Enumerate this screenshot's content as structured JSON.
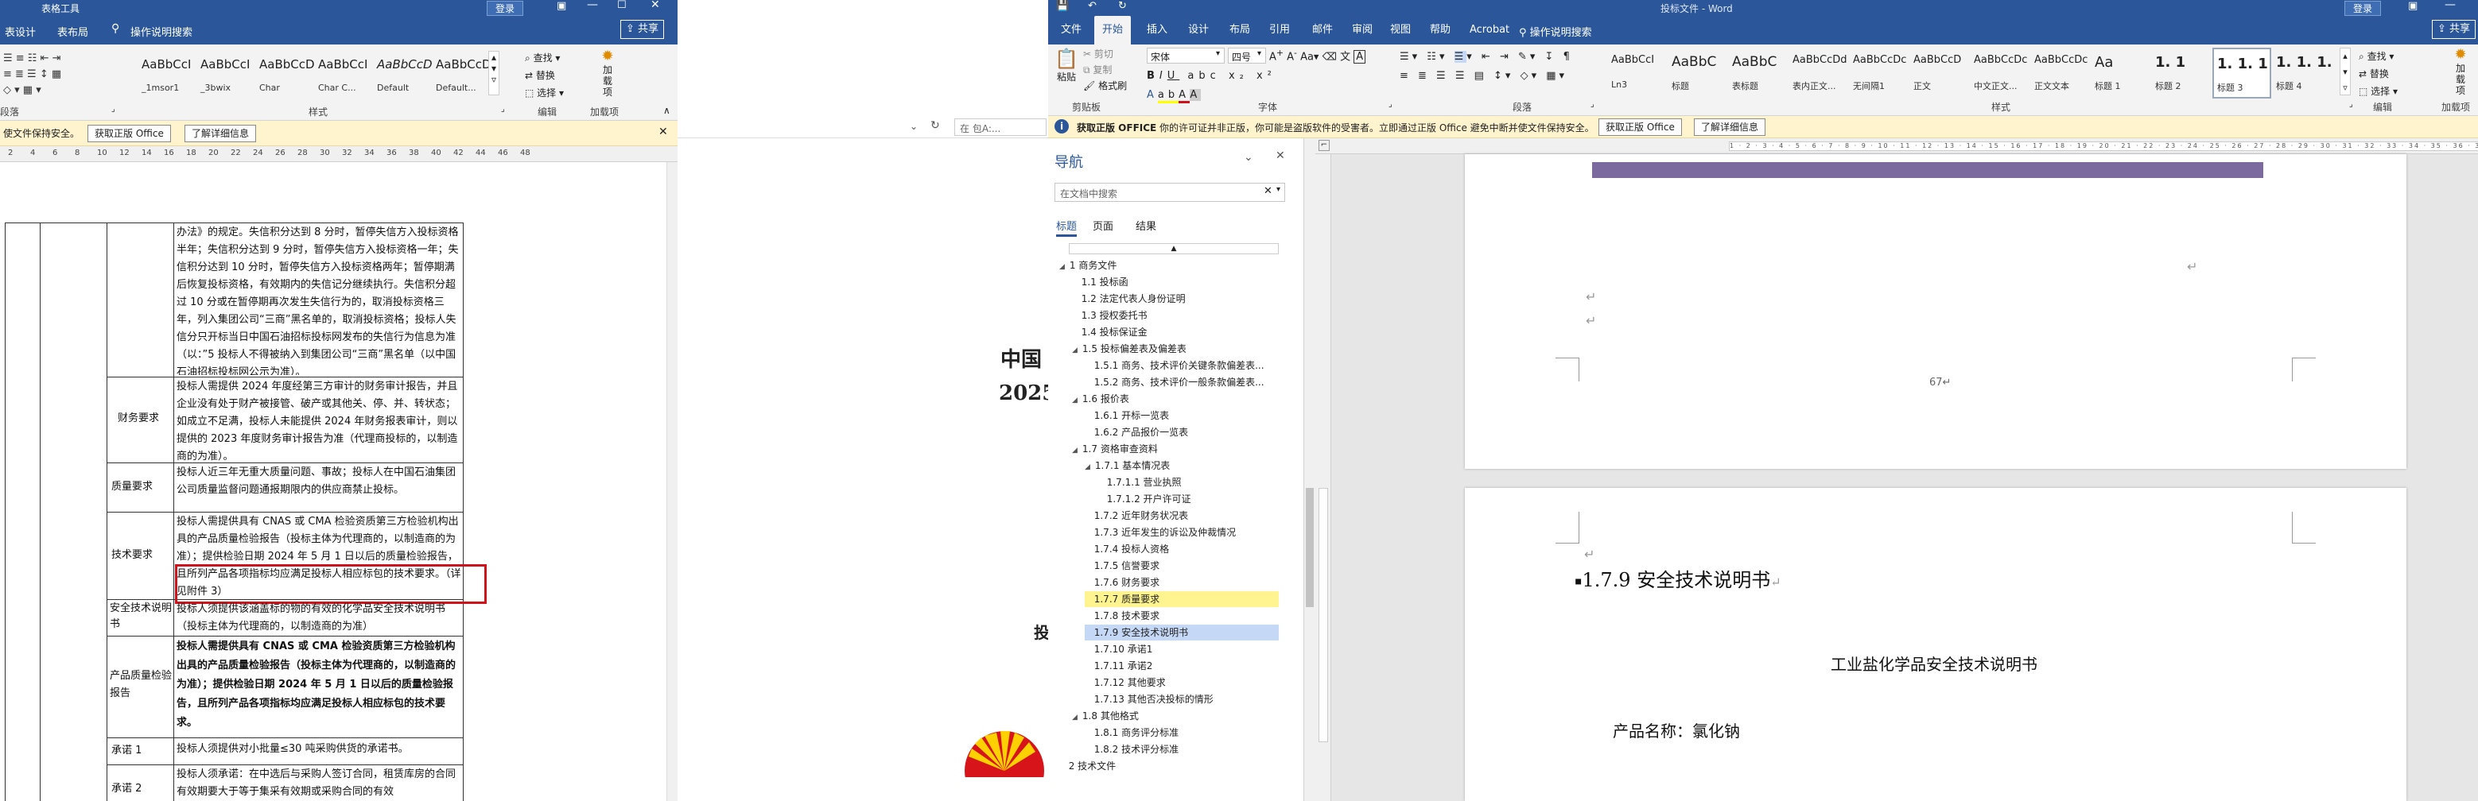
{
  "left_window": {
    "context_tab": "表格工具",
    "login": "登录",
    "tabs": [
      "表设计",
      "表布局"
    ],
    "search": "操作说明搜索",
    "share": "共享",
    "styles": [
      {
        "preview": "AaBbCcI",
        "name": "_1msor1"
      },
      {
        "preview": "AaBbCcI",
        "name": "_3bwix"
      },
      {
        "preview": "AaBbCcD",
        "name": "Char"
      },
      {
        "preview": "AaBbCcI",
        "name": "Char C..."
      },
      {
        "preview": "AaBbCcD",
        "name": "Default"
      },
      {
        "preview": "AaBbCcDc",
        "name": "Default..."
      }
    ],
    "find": "查找",
    "replace": "替换",
    "select": "选择",
    "group_labels": {
      "paragraph": "段落",
      "styles": "样式",
      "editing": "编辑",
      "addins": "加载项"
    },
    "addin": "加\n载\n项",
    "message": "使文件保持安全。",
    "btn_get_office": "获取正版 Office",
    "btn_learn_more": "了解详细信息",
    "ruler_numbers": [
      "2",
      "4",
      "6",
      "8",
      "10",
      "12",
      "14",
      "16",
      "18",
      "20",
      "22",
      "24",
      "26",
      "28",
      "30",
      "32",
      "34",
      "36",
      "38",
      "40",
      "42",
      "44",
      "46",
      "48"
    ],
    "table_rows": [
      {
        "label": "",
        "text": "办法》的规定。失信积分达到 8 分时，暂停失信方入投标资格半年；失信积分达到 9 分时，暂停失信方入投标资格一年；失信积分达到 10 分时，暂停失信方入投标资格两年；暂停期满后恢复投标资格，有效期内的失信记分继续执行。失信积分超过 10 分或在暂停期再次发生失信行为的，取消投标资格三年，列入集团公司“三商”黑名单的，取消投标资格；投标人失信分只开标当日中国石油招标投标网发布的失信行为信息为准（以：”5 投标人不得被纳入到集团公司“三商”黑名单（以中国石油招标投标网公示为准）。"
      },
      {
        "label": "财务要求",
        "text": "投标人需提供 2024 年度经第三方审计的财务审计报告，并且企业没有处于财产被接管、破产或其他关、停、并、转状态；如成立不足满，投标人未能提供 2024 年财务报表审计，则以提供的 2023 年度财务审计报告为准（代理商投标的，以制造商的为准）。"
      },
      {
        "label": "质量要求",
        "text": "投标人近三年无重大质量问题、事故；投标人在中国石油集团公司质量监督问题通报期限内的供应商禁止投标。"
      },
      {
        "label": "技术要求",
        "text": "投标人需提供具有 CNAS 或 CMA 检验资质第三方检验机构出具的产品质量检验报告（投标主体为代理商的，以制造商的为准）；提供检验日期 2024 年 5 月 1 日以后的质量检验报告，且所列产品各项指标均应满足投标人相应标包的技术要求。（详见附件 3）"
      },
      {
        "label": "安全技术说明书",
        "text": "投标人须提供该涵盖标的物的有效的化学品安全技术说明书（投标主体为代理商的，以制造商的为准）"
      },
      {
        "label": "产品质量检验报告",
        "text": "投标人需提供具有 CNAS 或 CMA 检验资质第三方检验机构出具的产品质量检验报告（投标主体为代理商的，以制造商的为准）；提供检验日期 2024 年 5 月 1 日以后的质量检验报告，且所列产品各项指标均应满足投标人相应标包的技术要求。"
      },
      {
        "label": "承诺 1",
        "text": "投标人须提供对小批量≤30 吨采购供货的承诺书。"
      },
      {
        "label": "承诺 2",
        "text": "投标人须承诺：在中选后与采购人签订合同，租赁库房的合同有效期要大于等于集采有效期或采购合同的有效"
      }
    ]
  },
  "middle_window": {
    "search_placeholder": "在 包A:...",
    "title_part1": "中国",
    "title_part2": "2025",
    "fragment": "投"
  },
  "right_window": {
    "title": "投标文件 - Word",
    "login": "登录",
    "tabs": [
      "文件",
      "开始",
      "插入",
      "设计",
      "布局",
      "引用",
      "邮件",
      "审阅",
      "视图",
      "帮助",
      "Acrobat"
    ],
    "active_tab": "开始",
    "search": "操作说明搜索",
    "share": "共享",
    "clipboard": {
      "cut": "剪切",
      "copy": "复制",
      "paste": "粘贴",
      "painter": "格式刷",
      "label": "剪贴板"
    },
    "font": {
      "name": "宋体",
      "size": "四号",
      "label": "字体"
    },
    "paragraph_label": "段落",
    "styles_label": "样式",
    "editing_label": "编辑",
    "addins_label": "加载项",
    "styles": [
      {
        "preview": "AaBbCcI",
        "name": "Ln3"
      },
      {
        "preview": "AaBbC",
        "name": "标题"
      },
      {
        "preview": "AaBbC",
        "name": "表标题"
      },
      {
        "preview": "AaBbCcDd",
        "name": "表内正文..."
      },
      {
        "preview": "AaBbCcDc",
        "name": "无间隔1"
      },
      {
        "preview": "AaBbCcD",
        "name": "正文"
      },
      {
        "preview": "AaBbCcDc",
        "name": "中文正文..."
      },
      {
        "preview": "AaBbCcDc",
        "name": "正文文本"
      },
      {
        "preview": "Aa",
        "name": "标题 1"
      },
      {
        "preview": "1. 1",
        "name": "标题 2"
      },
      {
        "preview": "1. 1. 1",
        "name": "标题 3"
      },
      {
        "preview": "1. 1. 1.",
        "name": "标题 4"
      }
    ],
    "find": "查找",
    "replace": "替换",
    "select": "选择",
    "addin": "加\n载\n项",
    "message_strong": "获取正版 OFFICE",
    "message": "你的许可证并非正版，你可能是盗版软件的受害者。立即通过正版 Office 避免中断并使文件保持安全。",
    "btn_get_office": "获取正版 Office",
    "btn_learn_more": "了解详细信息",
    "nav": {
      "title": "导航",
      "search_placeholder": "在文档中搜索",
      "tabs": [
        "标题",
        "页面",
        "结果"
      ],
      "items": [
        {
          "text": "1 商务文件",
          "level": 0,
          "state": ""
        },
        {
          "text": "1.1 投标函",
          "level": 1,
          "state": ""
        },
        {
          "text": "1.2 法定代表人身份证明",
          "level": 1,
          "state": ""
        },
        {
          "text": "1.3 授权委托书",
          "level": 1,
          "state": ""
        },
        {
          "text": "1.4 投标保证金",
          "level": 1,
          "state": ""
        },
        {
          "text": "1.5 投标偏差表及偏差表",
          "level": 1,
          "state": ""
        },
        {
          "text": "1.5.1 商务、技术评价关键条款偏差表...",
          "level": 2,
          "state": ""
        },
        {
          "text": "1.5.2 商务、技术评价一般条款偏差表...",
          "level": 2,
          "state": ""
        },
        {
          "text": "1.6 报价表",
          "level": 1,
          "state": ""
        },
        {
          "text": "1.6.1 开标一览表",
          "level": 2,
          "state": ""
        },
        {
          "text": "1.6.2 产品报价一览表",
          "level": 2,
          "state": ""
        },
        {
          "text": "1.7 资格审查资料",
          "level": 1,
          "state": ""
        },
        {
          "text": "1.7.1 基本情况表",
          "level": 2,
          "state": ""
        },
        {
          "text": "1.7.1.1 营业执照",
          "level": 3,
          "state": ""
        },
        {
          "text": "1.7.1.2 开户许可证",
          "level": 3,
          "state": ""
        },
        {
          "text": "1.7.2 近年财务状况表",
          "level": 2,
          "state": ""
        },
        {
          "text": "1.7.3 近年发生的诉讼及仲裁情况",
          "level": 2,
          "state": ""
        },
        {
          "text": "1.7.4 投标人资格",
          "level": 2,
          "state": ""
        },
        {
          "text": "1.7.5 信誉要求",
          "level": 2,
          "state": ""
        },
        {
          "text": "1.7.6 财务要求",
          "level": 2,
          "state": ""
        },
        {
          "text": "1.7.7 质量要求",
          "level": 2,
          "state": "hl"
        },
        {
          "text": "1.7.8 技术要求",
          "level": 2,
          "state": ""
        },
        {
          "text": "1.7.9 安全技术说明书",
          "level": 2,
          "state": "sel"
        },
        {
          "text": "1.7.10 承诺1",
          "level": 2,
          "state": ""
        },
        {
          "text": "1.7.11 承诺2",
          "level": 2,
          "state": ""
        },
        {
          "text": "1.7.12 其他要求",
          "level": 2,
          "state": ""
        },
        {
          "text": "1.7.13 其他否决投标的情形",
          "level": 2,
          "state": ""
        },
        {
          "text": "1.8 其他格式",
          "level": 1,
          "state": ""
        },
        {
          "text": "1.8.1 商务评分标准",
          "level": 2,
          "state": ""
        },
        {
          "text": "1.8.2 技术评分标准",
          "level": 2,
          "state": ""
        },
        {
          "text": "2 技术文件",
          "level": 0,
          "state": ""
        }
      ]
    },
    "page1_number": "67",
    "heading": "1.7.9  安全技术说明书",
    "doc_title": "工业盐化学品安全技术说明书",
    "product_line": "产品名称：氯化钠"
  },
  "colors": {
    "word_blue": "#2b579a",
    "ribbon": "#f3f3f3",
    "message": "#fff4ce",
    "highlight": "#fff48f",
    "selection": "#c5d8f6",
    "red_box": "#d0121b"
  }
}
